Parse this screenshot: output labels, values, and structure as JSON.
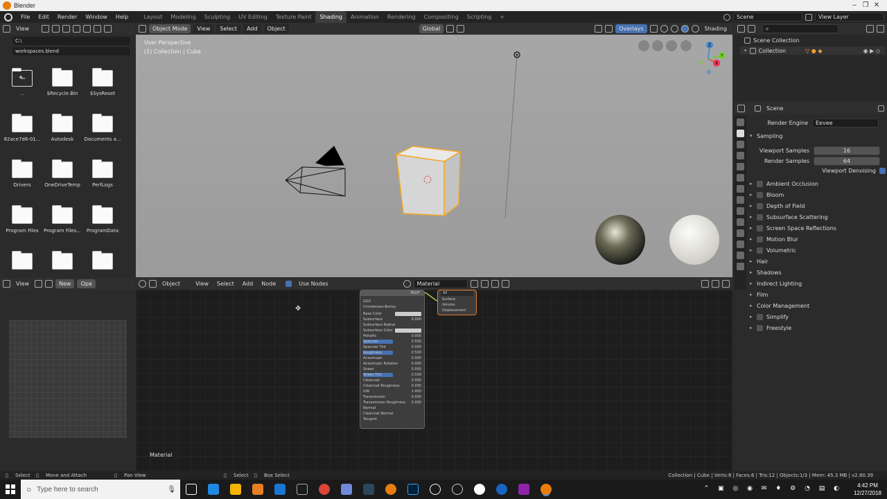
{
  "window": {
    "title": "Blender",
    "minimize": "–",
    "maximize": "❐",
    "close": "✕"
  },
  "menu": [
    "File",
    "Edit",
    "Render",
    "Window",
    "Help"
  ],
  "workspaces": [
    {
      "label": "Layout",
      "active": false
    },
    {
      "label": "Modeling",
      "active": false
    },
    {
      "label": "Sculpting",
      "active": false
    },
    {
      "label": "UV Editing",
      "active": false
    },
    {
      "label": "Texture Paint",
      "active": false
    },
    {
      "label": "Shading",
      "active": true
    },
    {
      "label": "Animation",
      "active": false
    },
    {
      "label": "Rendering",
      "active": false
    },
    {
      "label": "Compositing",
      "active": false
    },
    {
      "label": "Scripting",
      "active": false
    }
  ],
  "add_workspace": "+",
  "scene_field": "Scene",
  "view_layer_field": "View Layer",
  "file_browser": {
    "view_label": "View",
    "path": "C:\\",
    "filename": "workspaces.blend",
    "items": [
      {
        "label": ".."
      },
      {
        "label": "$Recycle.Bin"
      },
      {
        "label": "$SysReset"
      },
      {
        "label": "82ace7d6-01..."
      },
      {
        "label": "Autodesk"
      },
      {
        "label": "Documents a..."
      },
      {
        "label": "Drivers"
      },
      {
        "label": "OneDriveTemp"
      },
      {
        "label": "PerfLogs"
      },
      {
        "label": "Program Files"
      },
      {
        "label": "Program Files..."
      },
      {
        "label": "ProgramData"
      },
      {
        "label": ""
      },
      {
        "label": ""
      },
      {
        "label": ""
      }
    ]
  },
  "viewport": {
    "mode": "Object Mode",
    "menus": [
      "View",
      "Select",
      "Add",
      "Object"
    ],
    "orientation": "Global",
    "overlays": "Overlays",
    "shading": "Shading",
    "info_line1": "User Perspective",
    "info_line2": "(1) Collection | Cube",
    "axis_x": "X",
    "axis_y": "Y",
    "axis_z": "Z"
  },
  "outliner": {
    "scene_collection": "Scene Collection",
    "collection": "Collection"
  },
  "properties": {
    "context": "Scene",
    "render_engine_label": "Render Engine",
    "render_engine_value": "Eevee",
    "sampling": "Sampling",
    "viewport_samples_label": "Viewport Samples",
    "viewport_samples_value": "16",
    "render_samples_label": "Render Samples",
    "render_samples_value": "64",
    "viewport_denoising": "Viewport Denoising",
    "panels": [
      {
        "label": "Ambient Occlusion",
        "checkbox": true
      },
      {
        "label": "Bloom",
        "checkbox": true
      },
      {
        "label": "Depth of Field",
        "checkbox": true
      },
      {
        "label": "Subsurface Scattering",
        "checkbox": true
      },
      {
        "label": "Screen Space Reflections",
        "checkbox": true
      },
      {
        "label": "Motion Blur",
        "checkbox": true
      },
      {
        "label": "Volumetric",
        "checkbox": true
      },
      {
        "label": "Hair",
        "checkbox": false
      },
      {
        "label": "Shadows",
        "checkbox": false
      },
      {
        "label": "Indirect Lighting",
        "checkbox": false
      },
      {
        "label": "Film",
        "checkbox": false
      },
      {
        "label": "Color Management",
        "checkbox": false
      },
      {
        "label": "Simplify",
        "checkbox": true
      },
      {
        "label": "Freestyle",
        "checkbox": true
      }
    ]
  },
  "node_editor": {
    "left_view": "View",
    "new_button": "New",
    "open_button": "Ope",
    "object_type": "Object",
    "menus": [
      "View",
      "Select",
      "Add",
      "Node"
    ],
    "use_nodes": "Use Nodes",
    "material_field": "Material",
    "footer_label": "Material",
    "bsdf": {
      "title": "BSDF",
      "distribution": "GGX",
      "subsurface_method": "Christensen-Burley",
      "rows": [
        {
          "label": "Base Color",
          "value": "",
          "swatch": true,
          "bar": 0
        },
        {
          "label": "Subsurface",
          "value": "0.000",
          "bar": 0
        },
        {
          "label": "Subsurface Radius",
          "value": "",
          "bar": 0
        },
        {
          "label": "Subsurface Color",
          "value": "",
          "swatch": true,
          "bar": 0
        },
        {
          "label": "Metallic",
          "value": "0.000",
          "bar": 0
        },
        {
          "label": "Specular",
          "value": "0.500",
          "bar": 0.5
        },
        {
          "label": "Specular Tint",
          "value": "0.000",
          "bar": 0
        },
        {
          "label": "Roughness",
          "value": "0.500",
          "bar": 0.5
        },
        {
          "label": "Anisotropic",
          "value": "0.000",
          "bar": 0
        },
        {
          "label": "Anisotropic Rotation",
          "value": "0.000",
          "bar": 0
        },
        {
          "label": "Sheen",
          "value": "0.000",
          "bar": 0
        },
        {
          "label": "Sheen Tint",
          "value": "0.500",
          "bar": 0.5
        },
        {
          "label": "Clearcoat",
          "value": "0.000",
          "bar": 0
        },
        {
          "label": "Clearcoat Roughness",
          "value": "0.030",
          "bar": 0
        },
        {
          "label": "IOR",
          "value": "1.450",
          "bar": 0
        },
        {
          "label": "Transmission",
          "value": "0.000",
          "bar": 0
        },
        {
          "label": "Transmission Roughness",
          "value": "0.000",
          "bar": 0
        },
        {
          "label": "Normal",
          "value": "",
          "bar": 0
        },
        {
          "label": "Clearcoat Normal",
          "value": "",
          "bar": 0
        },
        {
          "label": "Tangent",
          "value": "",
          "bar": 0
        }
      ]
    },
    "output": {
      "target": "All",
      "sockets": [
        "Surface",
        "Volume",
        "Displacement"
      ]
    }
  },
  "status_bar": {
    "select": "Select",
    "move_attach": "Move and Attach",
    "pan_view": "Pan View",
    "select2": "Select",
    "box_select": "Box Select",
    "stats": "Collection | Cube | Verts:8 | Faces:6 | Tris:12 | Objects:1/3 | Mem: 45.3 MB | v2.80.39"
  },
  "taskbar": {
    "search_placeholder": "Type here to search",
    "time": "4:42 PM",
    "date": "12/27/2018"
  },
  "colors": {
    "accent": "#4772b3",
    "selection_orange": "#f5a623",
    "blender_orange": "#e87d0d"
  }
}
